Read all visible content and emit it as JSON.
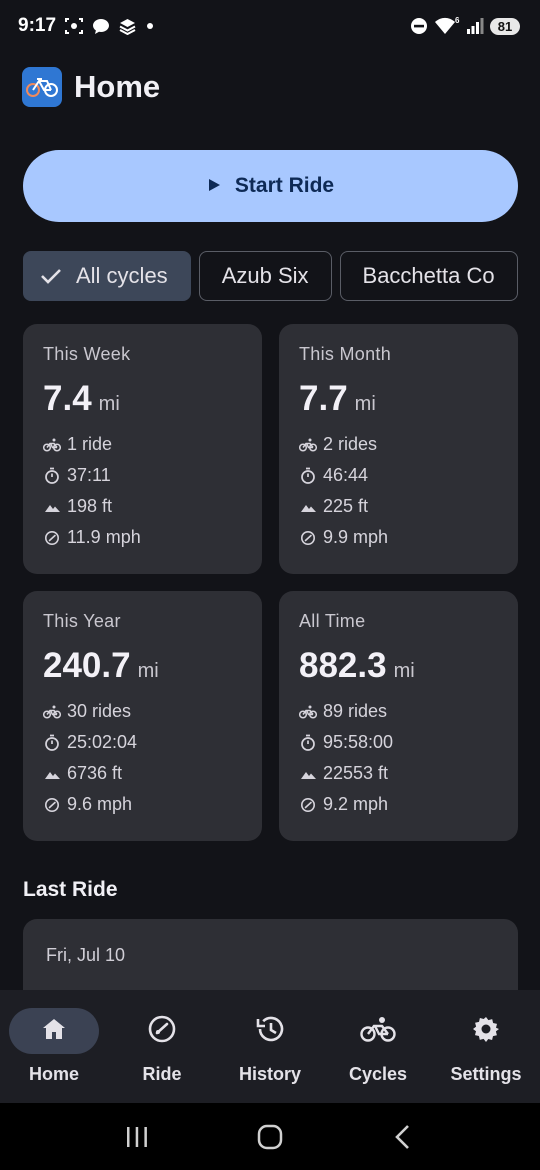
{
  "status_bar": {
    "time": "9:17",
    "battery": "81",
    "left_icons": [
      "screenshot-icon",
      "chat-bubble-icon",
      "stack-icon",
      "dot-icon"
    ],
    "right_icons": [
      "do-not-disturb-icon",
      "wifi-6-icon",
      "signal-icon",
      "battery-icon"
    ]
  },
  "app_bar": {
    "title": "Home",
    "logo_icon": "bicycle-logo-icon"
  },
  "start_ride": {
    "label": "Start Ride",
    "icon": "play-icon"
  },
  "chips": [
    {
      "label": "All cycles",
      "selected": true
    },
    {
      "label": "Azub Six",
      "selected": false
    },
    {
      "label": "Bacchetta Co",
      "selected": false
    }
  ],
  "stats": [
    {
      "title": "This Week",
      "distance": "7.4",
      "unit": "mi",
      "rides": "1 ride",
      "duration": "37:11",
      "elevation": "198 ft",
      "speed": "11.9 mph"
    },
    {
      "title": "This Month",
      "distance": "7.7",
      "unit": "mi",
      "rides": "2 rides",
      "duration": "46:44",
      "elevation": "225 ft",
      "speed": "9.9 mph"
    },
    {
      "title": "This Year",
      "distance": "240.7",
      "unit": "mi",
      "rides": "30 rides",
      "duration": "25:02:04",
      "elevation": "6736 ft",
      "speed": "9.6 mph"
    },
    {
      "title": "All Time",
      "distance": "882.3",
      "unit": "mi",
      "rides": "89 rides",
      "duration": "95:58:00",
      "elevation": "22553 ft",
      "speed": "9.2 mph"
    }
  ],
  "last_ride": {
    "section_title": "Last Ride",
    "date": "Fri, Jul 10"
  },
  "bottom_nav": [
    {
      "label": "Home",
      "icon": "home-icon",
      "active": true
    },
    {
      "label": "Ride",
      "icon": "speedometer-icon",
      "active": false
    },
    {
      "label": "History",
      "icon": "history-icon",
      "active": false
    },
    {
      "label": "Cycles",
      "icon": "bicycle-icon",
      "active": false
    },
    {
      "label": "Settings",
      "icon": "gear-icon",
      "active": false
    }
  ],
  "colors": {
    "background": "#121318",
    "card": "#2e2f35",
    "accent": "#a8c8ff",
    "chip_selected": "#3d4759",
    "nav_background": "#1d1e24"
  }
}
